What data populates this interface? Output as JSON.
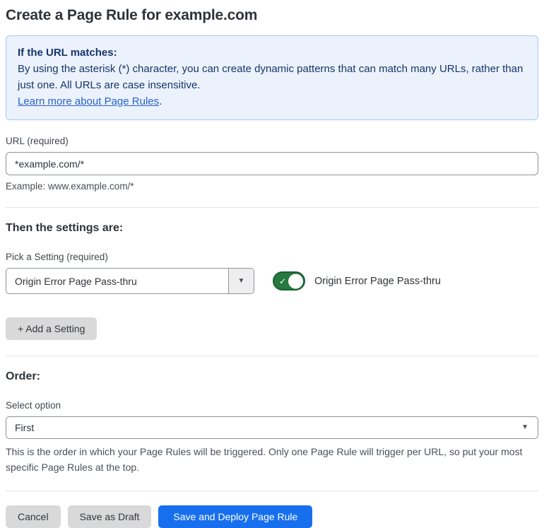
{
  "page": {
    "title": "Create a Page Rule for example.com"
  },
  "info_box": {
    "heading": "If the URL matches:",
    "body": "By using the asterisk (*) character, you can create dynamic patterns that can match many URLs, rather than just one. All URLs are case insensitive.",
    "link_label": "Learn more about Page Rules",
    "link_suffix": "."
  },
  "url_field": {
    "label": "URL (required)",
    "value": "*example.com/*",
    "helper": "Example: www.example.com/*"
  },
  "settings_section": {
    "heading": "Then the settings are:",
    "picker_label": "Pick a Setting (required)",
    "selected_setting": "Origin Error Page Pass-thru",
    "dropdown_caret_glyph": "▼",
    "toggle": {
      "state": "on",
      "check_glyph": "✓",
      "label": "Origin Error Page Pass-thru"
    },
    "add_button_label": "+ Add a Setting"
  },
  "order_section": {
    "heading": "Order:",
    "select_label": "Select option",
    "selected_option": "First",
    "select_caret_glyph": "▼",
    "helper": "This is the order in which your Page Rules will be triggered. Only one Page Rule will trigger per URL, so put your most specific Page Rules at the top."
  },
  "footer": {
    "cancel_label": "Cancel",
    "save_draft_label": "Save as Draft",
    "save_deploy_label": "Save and Deploy Page Rule"
  },
  "colors": {
    "info_box_bg": "#ebf2fc",
    "info_box_border": "#a9c8ee",
    "info_box_text": "#17356b",
    "link_blue": "#2b62c9",
    "toggle_green": "#26793f",
    "toggle_green_border": "#1d6233",
    "primary_button_blue": "#176fee",
    "secondary_button_gray": "#d9d9d9"
  }
}
